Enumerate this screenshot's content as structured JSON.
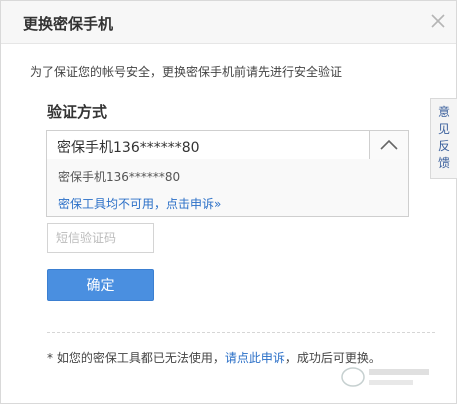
{
  "dialog": {
    "title": "更换密保手机",
    "close_icon": "close-icon",
    "intro": "为了保证您的帐号安全，更换密保手机前请先进行安全验证"
  },
  "verify": {
    "section_label": "验证方式",
    "selected_method": "密保手机136******80",
    "toggle_icon": "chevron-up-icon",
    "dropdown": {
      "option": "密保手机136******80",
      "link": "密保工具均不可用，点击申诉»"
    },
    "sms_placeholder": "短信验证码",
    "confirm_label": "确定"
  },
  "footer": {
    "note_prefix": "* 如您的密保工具都已无法使用，",
    "note_link": "请点此申诉",
    "note_suffix": "，成功后可更换。"
  },
  "side_tab": {
    "label": "意见反馈"
  },
  "colors": {
    "accent": "#4a8fe0",
    "link": "#2a6fc7",
    "titlebar": "#f7f7f7"
  }
}
